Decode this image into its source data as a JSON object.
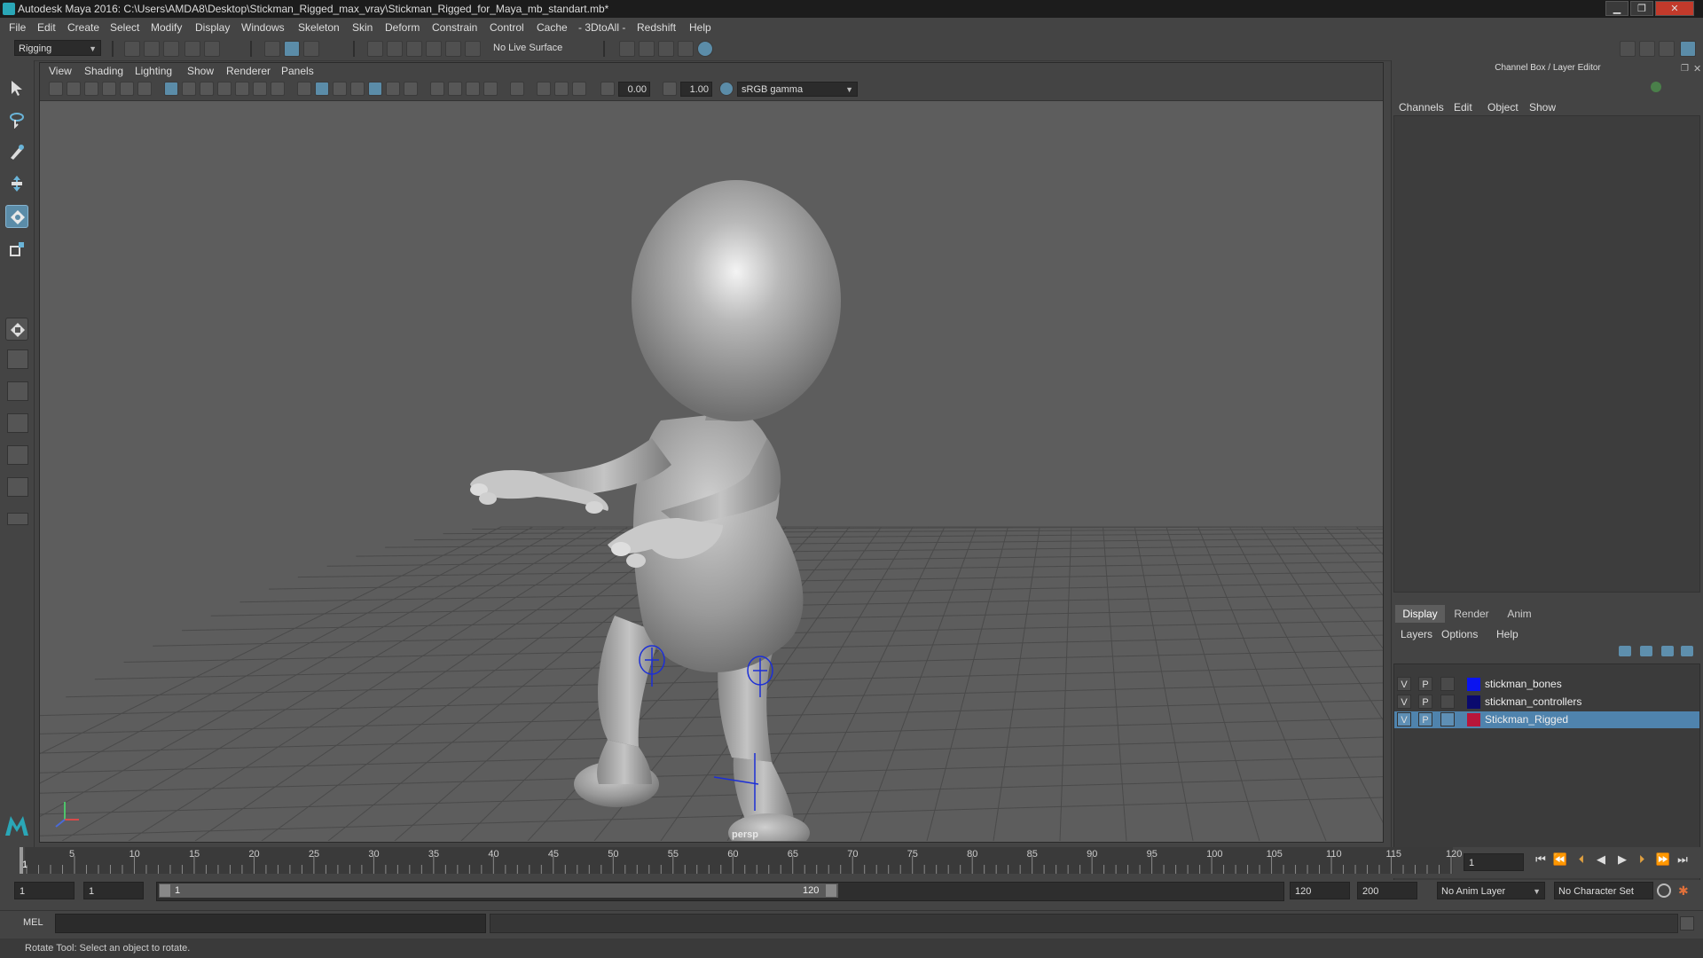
{
  "window": {
    "title": "Autodesk Maya 2016: C:\\Users\\AMDA8\\Desktop\\Stickman_Rigged_max_vray\\Stickman_Rigged_for_Maya_mb_standart.mb*",
    "minimize": "▁",
    "maximize": "❐",
    "close": "✕"
  },
  "menubar": [
    "File",
    "Edit",
    "Create",
    "Select",
    "Modify",
    "Display",
    "Windows",
    "Skeleton",
    "Skin",
    "Deform",
    "Constrain",
    "Control",
    "Cache",
    "- 3DtoAll -",
    "Redshift",
    "Help"
  ],
  "statusline": {
    "menuset": "Rigging",
    "live_surface": "No Live Surface"
  },
  "panel": {
    "menus": [
      "View",
      "Shading",
      "Lighting",
      "Show",
      "Renderer",
      "Panels"
    ],
    "exposure": "0.00",
    "gamma": "1.00",
    "colorspace": "sRGB gamma",
    "camera": "persp"
  },
  "rightpanel": {
    "title": "Channel Box / Layer Editor",
    "menus": [
      "Channels",
      "Edit",
      "Object",
      "Show"
    ],
    "tabs": [
      "Display",
      "Render",
      "Anim"
    ],
    "layer_menus": [
      "Layers",
      "Options",
      "Help"
    ],
    "layers": [
      {
        "v": "V",
        "p": "P",
        "name": "stickman_bones",
        "color": "#0a14f0",
        "selected": false
      },
      {
        "v": "V",
        "p": "P",
        "name": "stickman_controllers",
        "color": "#0a0a6e",
        "selected": false
      },
      {
        "v": "V",
        "p": "P",
        "name": "Stickman_Rigged",
        "color": "#b8163a",
        "selected": true
      }
    ]
  },
  "timeline": {
    "ticks": [
      "5",
      "10",
      "15",
      "20",
      "25",
      "30",
      "35",
      "40",
      "45",
      "50",
      "55",
      "60",
      "65",
      "70",
      "75",
      "80",
      "85",
      "90",
      "95",
      "100",
      "105",
      "110",
      "115",
      "120"
    ],
    "current_marker": "1",
    "current_frame": "1"
  },
  "range": {
    "start": "1",
    "playback_start": "1",
    "slider_start": "1",
    "slider_end": "120",
    "playback_end": "120",
    "end": "200",
    "anim_layer": "No Anim Layer",
    "character_set": "No Character Set"
  },
  "command": {
    "lang": "MEL"
  },
  "helpline": "Rotate Tool: Select an object to rotate."
}
